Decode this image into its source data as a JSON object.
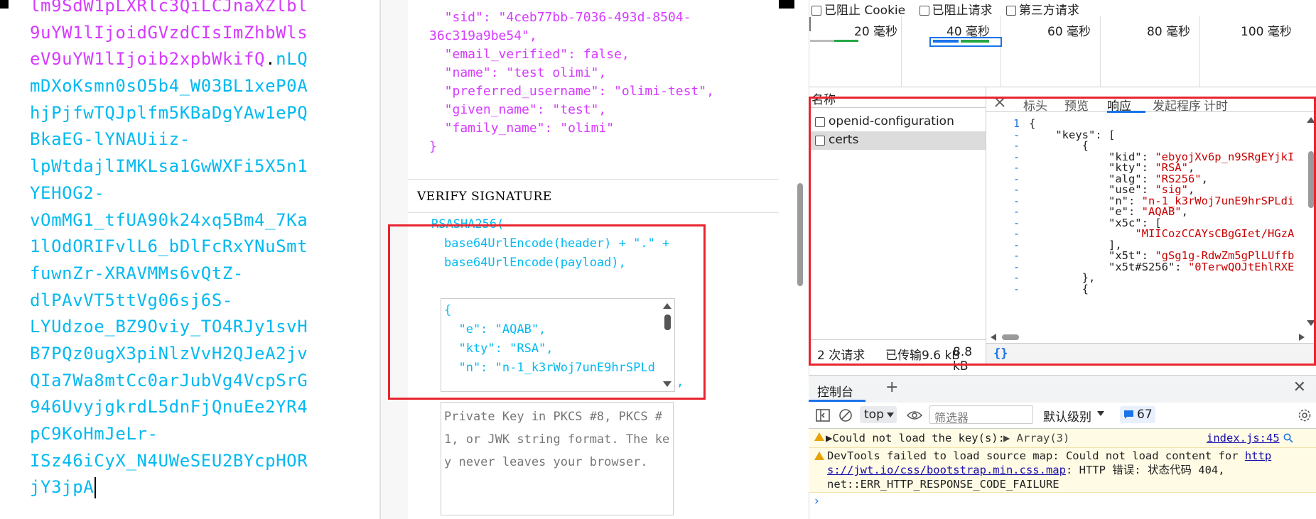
{
  "encoded": {
    "lines": [
      {
        "parts": [
          {
            "t": "lm9SdW1pLXRlc3QiLCJnaXZlbl",
            "c": "pay"
          }
        ]
      },
      {
        "parts": [
          {
            "t": "9uYW1lIjoidGVzdCIsImZhbWls",
            "c": "pay"
          }
        ]
      },
      {
        "parts": [
          {
            "t": "eV9uYW1lIjoib2xpbWkifQ",
            "c": "pay"
          },
          {
            "t": ".",
            "c": "dot"
          },
          {
            "t": "nLQ",
            "c": "sig"
          }
        ]
      },
      {
        "parts": [
          {
            "t": "mDXoKsmn0sO5b4_W03BL1xeP0A",
            "c": "sig"
          }
        ]
      },
      {
        "parts": [
          {
            "t": "hjPjfwTQJplfm5KBaDgYAw1ePQ",
            "c": "sig"
          }
        ]
      },
      {
        "parts": [
          {
            "t": "BkaEG-lYNAUiiz-",
            "c": "sig"
          }
        ]
      },
      {
        "parts": [
          {
            "t": "lpWtdajlIMKLsa1GwWXFi5X5n1",
            "c": "sig"
          }
        ]
      },
      {
        "parts": [
          {
            "t": "YEHOG2-",
            "c": "sig"
          }
        ]
      },
      {
        "parts": [
          {
            "t": "vOmMG1_tfUA90k24xq5Bm4_7Ka",
            "c": "sig"
          }
        ]
      },
      {
        "parts": [
          {
            "t": "1lOdORIFvlL6_bDlFcRxYNuSmt",
            "c": "sig"
          }
        ]
      },
      {
        "parts": [
          {
            "t": "fuwnZr-XRAVMMs6vQtZ-",
            "c": "sig"
          }
        ]
      },
      {
        "parts": [
          {
            "t": "dlPAvVT5ttVg06sj6S-",
            "c": "sig"
          }
        ]
      },
      {
        "parts": [
          {
            "t": "LYUdzoe_BZ9Oviy_TO4RJy1svH",
            "c": "sig"
          }
        ]
      },
      {
        "parts": [
          {
            "t": "B7PQz0ugX3piNlzVvH2QJeA2jv",
            "c": "sig"
          }
        ]
      },
      {
        "parts": [
          {
            "t": "QIa7Wa8mtCc0arJubVg4VcpSrG",
            "c": "sig"
          }
        ]
      },
      {
        "parts": [
          {
            "t": "946UvyjgkrdL5dnFjQnuEe2YR4",
            "c": "sig"
          }
        ]
      },
      {
        "parts": [
          {
            "t": "pC9KoHmJeLr-",
            "c": "sig"
          }
        ]
      },
      {
        "parts": [
          {
            "t": "ISz46iCyX_N4UWeSEU2BYcpHOR",
            "c": "sig"
          }
        ]
      },
      {
        "parts": [
          {
            "t": "jY3jpA",
            "c": "sig"
          }
        ]
      }
    ]
  },
  "payload_json": "  \"sid\": \"4ceb77bb-7036-493d-8504-\n36c319a9be54\",\n  \"email_verified\": false,\n  \"name\": \"test olimi\",\n  \"preferred_username\": \"olimi-test\",\n  \"given_name\": \"test\",\n  \"family_name\": \"olimi\"\n}",
  "verify": {
    "title": "VERIFY SIGNATURE",
    "algo": "RSASHA256(",
    "line1": "base64UrlEncode(header) + \".\" +",
    "line2": "base64UrlEncode(payload),",
    "key_lines": [
      "{",
      "  \"e\": \"AQAB\",",
      "  \"kty\": \"RSA\",",
      "  \"n\": \"n-1_k3rWoj7unE9hrSPLd"
    ],
    "trailing_comma": ",",
    "private_key_placeholder": "Private Key in PKCS #8, PKCS #1, or JWK string format. The key never leaves your browser."
  },
  "devtools": {
    "filters": [
      "已阻止 Cookie",
      "已阻止请求",
      "第三方请求"
    ],
    "timeline_ticks": [
      "20 毫秒",
      "40 毫秒",
      "60 毫秒",
      "80 毫秒",
      "100 毫秒"
    ],
    "col_name": "名称",
    "requests": [
      "openid-configuration",
      "certs"
    ],
    "status_requests": "2 次请求",
    "status_transferred": "已传输9.6 kB",
    "status_size": "8.8 kB",
    "tabs": [
      "标头",
      "预览",
      "响应",
      "发起程序",
      "计时"
    ],
    "active_tab": "响应",
    "pretty_print": "{}",
    "response_lines": [
      {
        "n": "1",
        "code": [
          {
            "t": "{",
            "c": "k"
          }
        ]
      },
      {
        "n": "-",
        "code": [
          {
            "t": "    \"keys\": [",
            "c": "k"
          }
        ]
      },
      {
        "n": "-",
        "code": [
          {
            "t": "        {",
            "c": "k"
          }
        ]
      },
      {
        "n": "-",
        "code": [
          {
            "t": "            \"kid\": ",
            "c": "k"
          },
          {
            "t": "\"ebyojXv6p_n9SRgEYjkI",
            "c": "s"
          }
        ]
      },
      {
        "n": "-",
        "code": [
          {
            "t": "            \"kty\": ",
            "c": "k"
          },
          {
            "t": "\"RSA\"",
            "c": "s"
          },
          {
            "t": ",",
            "c": "k"
          }
        ]
      },
      {
        "n": "-",
        "code": [
          {
            "t": "            \"alg\": ",
            "c": "k"
          },
          {
            "t": "\"RS256\"",
            "c": "s"
          },
          {
            "t": ",",
            "c": "k"
          }
        ]
      },
      {
        "n": "-",
        "code": [
          {
            "t": "            \"use\": ",
            "c": "k"
          },
          {
            "t": "\"sig\"",
            "c": "s"
          },
          {
            "t": ",",
            "c": "k"
          }
        ]
      },
      {
        "n": "-",
        "code": [
          {
            "t": "            \"n\": ",
            "c": "k"
          },
          {
            "t": "\"n-1_k3rWoj7unE9hrSPLdi",
            "c": "s"
          }
        ]
      },
      {
        "n": "-",
        "code": [
          {
            "t": "            \"e\": ",
            "c": "k"
          },
          {
            "t": "\"AQAB\"",
            "c": "s"
          },
          {
            "t": ",",
            "c": "k"
          }
        ]
      },
      {
        "n": "-",
        "code": [
          {
            "t": "            \"x5c\": [",
            "c": "k"
          }
        ]
      },
      {
        "n": "-",
        "code": [
          {
            "t": "                ",
            "c": "k"
          },
          {
            "t": "\"MIICozCCAYsCBgGIet/HGzA",
            "c": "s"
          }
        ]
      },
      {
        "n": "-",
        "code": [
          {
            "t": "            ],",
            "c": "k"
          }
        ]
      },
      {
        "n": "-",
        "code": [
          {
            "t": "            \"x5t\": ",
            "c": "k"
          },
          {
            "t": "\"gSg1g-RdwZm5gPlLUffb",
            "c": "s"
          }
        ]
      },
      {
        "n": "-",
        "code": [
          {
            "t": "            \"x5t#S256\": ",
            "c": "k"
          },
          {
            "t": "\"0TerwQOJtEhlRXE",
            "c": "s"
          }
        ]
      },
      {
        "n": "-",
        "code": [
          {
            "t": "        },",
            "c": "k"
          }
        ]
      },
      {
        "n": "-",
        "code": [
          {
            "t": "        {",
            "c": "k"
          }
        ]
      }
    ],
    "console": {
      "tab": "控制台",
      "context": "top",
      "filter_placeholder": "筛选器",
      "level": "默认级别",
      "count": "67",
      "msg1_text": "▶Could not load the key(s):",
      "msg1_arr": "▶ Array(3)",
      "msg1_src": "index.js:45",
      "msg2_a": "DevTools failed to load source map: Could not load content for ",
      "msg2_link1": "http",
      "msg2_link2": "s://jwt.io/css/bootstrap.min.css.map",
      "msg2_b": ": HTTP 错误: 状态代码 404,",
      "msg2_c": "net::ERR_HTTP_RESPONSE_CODE_FAILURE",
      "prompt": "›"
    }
  }
}
